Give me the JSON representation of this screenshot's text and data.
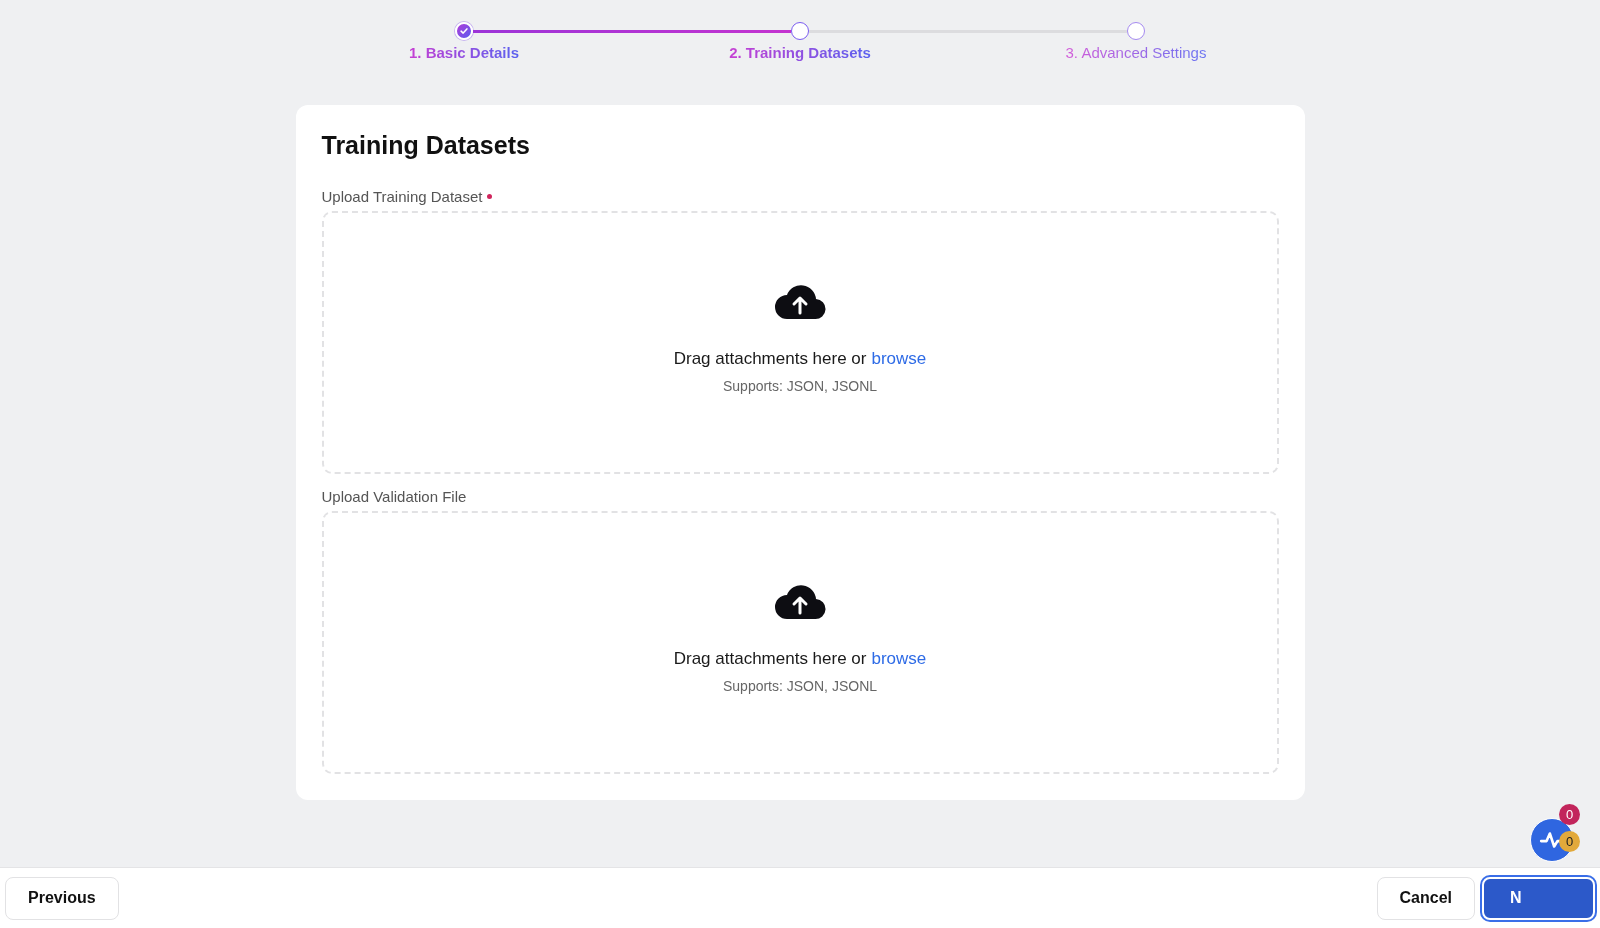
{
  "stepper": {
    "steps": [
      {
        "label": "1. Basic Details",
        "completed": true,
        "selected": false
      },
      {
        "label": "2. Training Datasets",
        "completed": false,
        "selected": true
      },
      {
        "label": "3. Advanced Settings",
        "completed": false,
        "selected": false
      }
    ]
  },
  "card": {
    "title": "Training Datasets",
    "uploads": [
      {
        "label": "Upload Training Dataset",
        "required": true,
        "prompt": "Drag attachments here or",
        "link": "browse",
        "hint": "Supports: JSON, JSONL"
      },
      {
        "label": "Upload Validation File",
        "required": false,
        "prompt": "Drag attachments here or",
        "link": "browse",
        "hint": "Supports: JSON, JSONL"
      }
    ]
  },
  "footer": {
    "previous": "Previous",
    "cancel": "Cancel",
    "next": "N"
  },
  "widget": {
    "badges": [
      {
        "count": "0",
        "color": "#c2255c"
      },
      {
        "count": "0",
        "color": "#e2a93b"
      }
    ]
  }
}
